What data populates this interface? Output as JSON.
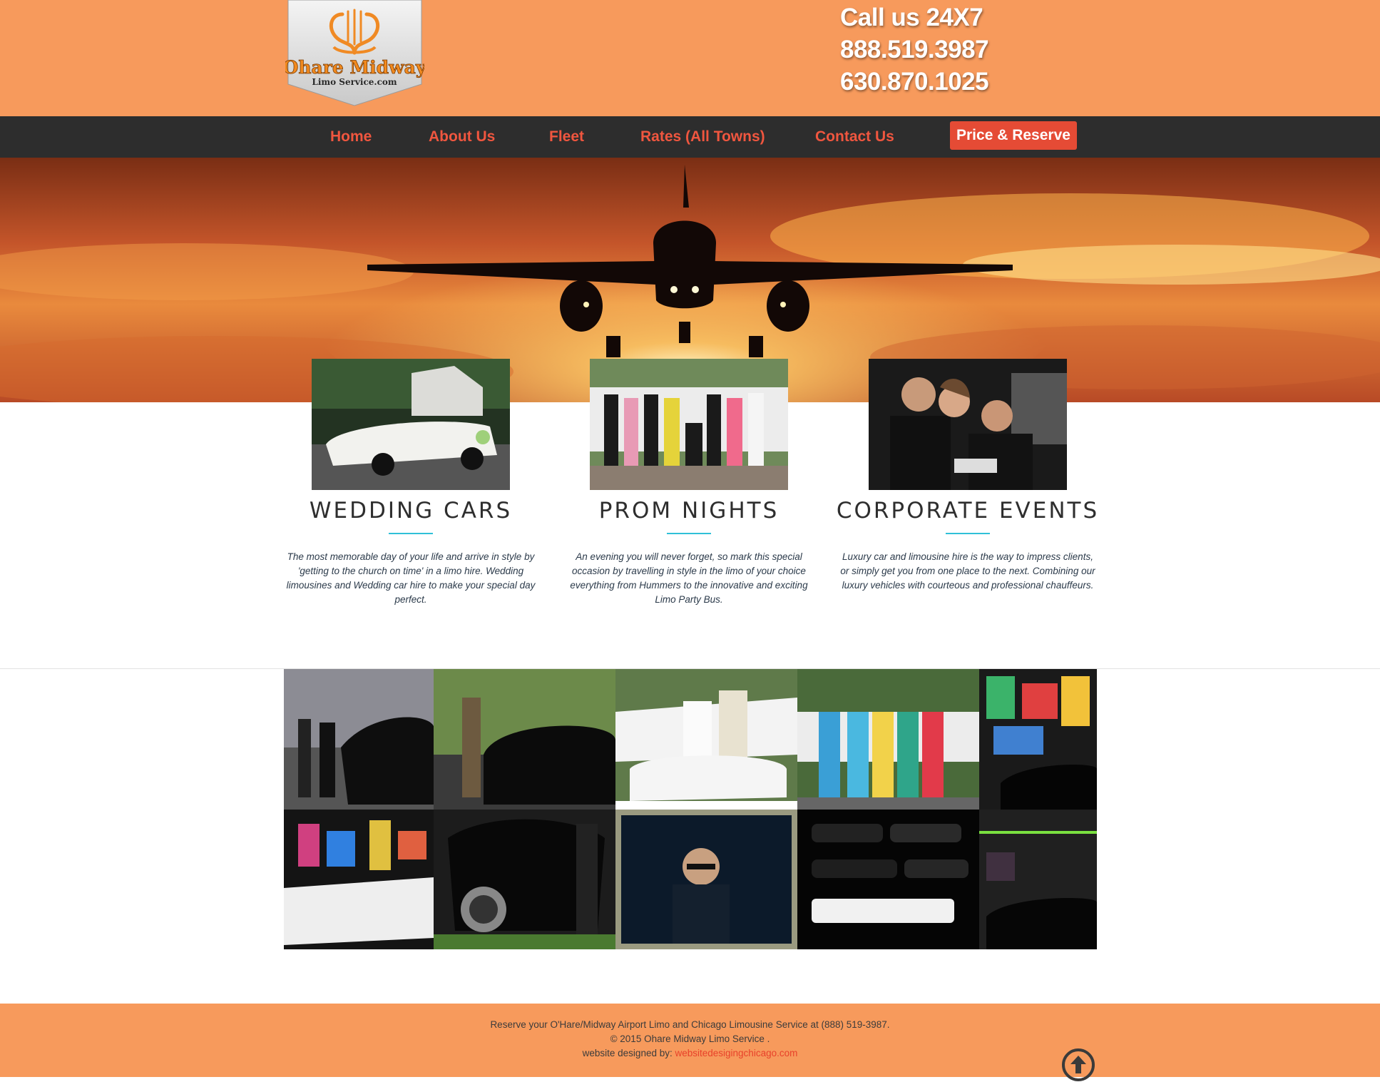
{
  "header": {
    "logo_title": "Ohare Midway",
    "logo_subtitle": "Limo Service.com",
    "call_label": "Call us 24X7",
    "phone_1": "888.519.3987",
    "phone_2": "630.870.1025"
  },
  "nav": {
    "items": [
      "Home",
      "About Us",
      "Fleet",
      "Rates (All Towns)",
      "Contact Us"
    ],
    "cta": "Price & Reserve"
  },
  "colors": {
    "brand_orange": "#f79a5c",
    "nav_bg": "#2d2d2d",
    "nav_link": "#f0563f",
    "cta_bg": "#e54b35",
    "accent_rule": "#2fc0d8"
  },
  "features": [
    {
      "title": "WEDDING CARS",
      "text": "The most memorable day of your life and arrive in style by 'getting to the church on time' in a limo hire. Wedding limousines and Wedding car hire to make your special day perfect."
    },
    {
      "title": "PROM NIGHTS",
      "text": "An evening you will never forget, so mark this special occasion by travelling in style in the limo of your choice everything from Hummers to the innovative and exciting Limo Party Bus."
    },
    {
      "title": "CORPORATE EVENTS",
      "text": "Luxury car and limousine hire is the way to impress clients, or simply get you from one place to the next. Combining our luxury vehicles with courteous and professional chauffeurs."
    }
  ],
  "footer": {
    "line_1": "Reserve your O'Hare/Midway Airport Limo and Chicago Limousine Service at (888) 519-3987.",
    "line_2": "© 2015 Ohare Midway Limo Service .",
    "designed_by_label": "website designed by:",
    "designed_by_link": "websitedesigingchicago.com",
    "back_to_top_icon": "arrow-up-circle-icon"
  }
}
